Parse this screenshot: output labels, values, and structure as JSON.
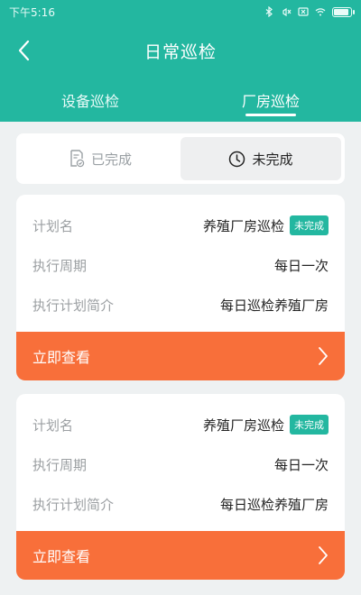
{
  "status_bar": {
    "time": "下午5:16"
  },
  "header": {
    "title": "日常巡检"
  },
  "tabs": [
    {
      "label": "设备巡检",
      "active": false
    },
    {
      "label": "厂房巡检",
      "active": true
    }
  ],
  "segments": [
    {
      "label": "已完成",
      "icon": "document-check-icon",
      "active": false
    },
    {
      "label": "未完成",
      "icon": "clock-icon",
      "active": true
    }
  ],
  "cards": [
    {
      "plan_name_label": "计划名",
      "plan_name": "养殖厂房巡检",
      "badge": "未完成",
      "cycle_label": "执行周期",
      "cycle": "每日一次",
      "desc_label": "执行计划简介",
      "desc": "每日巡检养殖厂房",
      "action_label": "立即查看"
    },
    {
      "plan_name_label": "计划名",
      "plan_name": "养殖厂房巡检",
      "badge": "未完成",
      "cycle_label": "执行周期",
      "cycle": "每日一次",
      "desc_label": "执行计划简介",
      "desc": "每日巡检养殖厂房",
      "action_label": "立即查看"
    }
  ],
  "colors": {
    "primary": "#23b7a0",
    "action": "#f86f3a",
    "background": "#eef1f2"
  }
}
